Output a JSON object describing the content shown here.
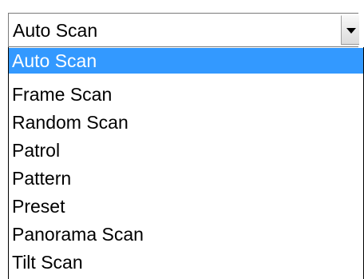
{
  "select": {
    "value": "Auto Scan",
    "arrow_icon": "chevron-down-icon"
  },
  "options": [
    {
      "label": "Auto Scan",
      "selected": true
    },
    {
      "label": "Frame Scan",
      "selected": false
    },
    {
      "label": "Random Scan",
      "selected": false
    },
    {
      "label": "Patrol",
      "selected": false
    },
    {
      "label": "Pattern",
      "selected": false
    },
    {
      "label": "Preset",
      "selected": false
    },
    {
      "label": "Panorama Scan",
      "selected": false
    },
    {
      "label": "Tilt Scan",
      "selected": false
    }
  ],
  "colors": {
    "selection_background": "#3399ff",
    "selection_text": "#ffffff",
    "text": "#000000",
    "border": "#000000"
  }
}
